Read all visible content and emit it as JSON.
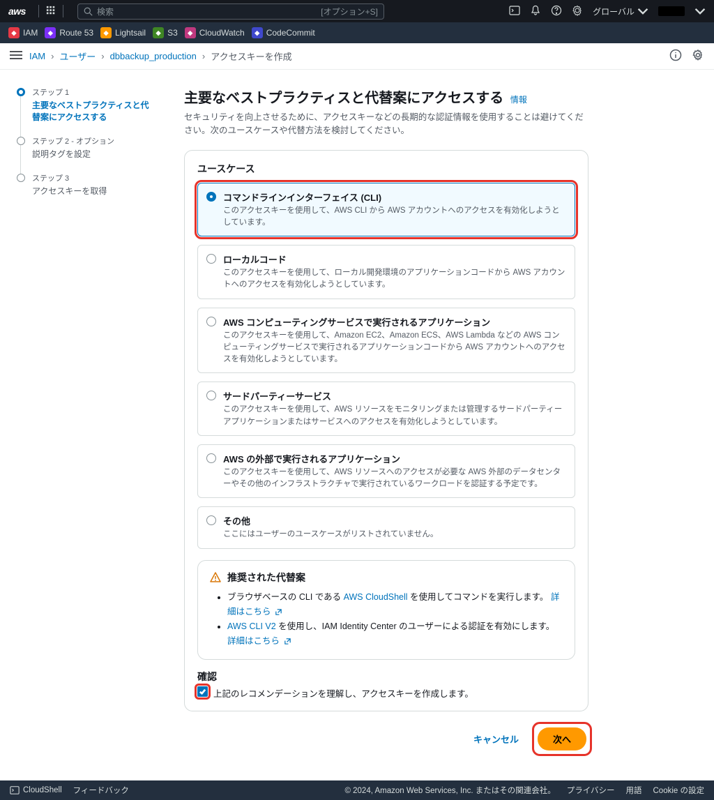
{
  "topnav": {
    "logo_text": "aws",
    "search_placeholder": "検索",
    "search_hint": "[オプション+S]",
    "region": "グローバル"
  },
  "servicebar": [
    {
      "label": "IAM",
      "color": "#e63946"
    },
    {
      "label": "Route 53",
      "color": "#7b2ff7"
    },
    {
      "label": "Lightsail",
      "color": "#ff9900"
    },
    {
      "label": "S3",
      "color": "#3f8624"
    },
    {
      "label": "CloudWatch",
      "color": "#c0397f"
    },
    {
      "label": "CodeCommit",
      "color": "#3f48cc"
    }
  ],
  "breadcrumb": {
    "items": [
      "IAM",
      "ユーザー",
      "dbbackup_production"
    ],
    "current": "アクセスキーを作成"
  },
  "stepper": [
    {
      "label": "ステップ 1",
      "title": "主要なベストプラクティスと代替案にアクセスする"
    },
    {
      "label": "ステップ 2 - オプション",
      "title": "説明タグを設定"
    },
    {
      "label": "ステップ 3",
      "title": "アクセスキーを取得"
    }
  ],
  "main": {
    "heading": "主要なベストプラクティスと代替案にアクセスする",
    "info": "情報",
    "subhead": "セキュリティを向上させるために、アクセスキーなどの長期的な認証情報を使用することは避けてください。次のユースケースや代替方法を検討してください。",
    "usecase_title": "ユースケース",
    "options": [
      {
        "title": "コマンドラインインターフェイス (CLI)",
        "desc": "このアクセスキーを使用して、AWS CLI から AWS アカウントへのアクセスを有効化しようとしています。"
      },
      {
        "title": "ローカルコード",
        "desc": "このアクセスキーを使用して、ローカル開発環境のアプリケーションコードから AWS アカウントへのアクセスを有効化しようとしています。"
      },
      {
        "title": "AWS コンピューティングサービスで実行されるアプリケーション",
        "desc": "このアクセスキーを使用して、Amazon EC2、Amazon ECS、AWS Lambda などの AWS コンピューティングサービスで実行されるアプリケーションコードから AWS アカウントへのアクセスを有効化しようとしています。"
      },
      {
        "title": "サードパーティーサービス",
        "desc": "このアクセスキーを使用して、AWS リソースをモニタリングまたは管理するサードパーティーアプリケーションまたはサービスへのアクセスを有効化しようとしています。"
      },
      {
        "title": "AWS の外部で実行されるアプリケーション",
        "desc": "このアクセスキーを使用して、AWS リソースへのアクセスが必要な AWS 外部のデータセンターやその他のインフラストラクチャで実行されているワークロードを認証する予定です。"
      },
      {
        "title": "その他",
        "desc": "ここにはユーザーのユースケースがリストされていません。"
      }
    ],
    "alert": {
      "title": "推奨された代替案",
      "b1_pre": "ブラウザベースの CLI である ",
      "b1_link": "AWS CloudShell",
      "b1_post": " を使用してコマンドを実行します。 ",
      "b1_more": "詳細はこちら",
      "b2_link": "AWS CLI V2",
      "b2_post": " を使用し、IAM Identity Center のユーザーによる認証を有効にします。 ",
      "b2_more": "詳細はこちら"
    },
    "confirm_label": "確認",
    "confirm_text": "上記のレコメンデーションを理解し、アクセスキーを作成します。",
    "cancel": "キャンセル",
    "next": "次へ"
  },
  "footer": {
    "cloudshell": "CloudShell",
    "feedback": "フィードバック",
    "copyright": "© 2024, Amazon Web Services, Inc. またはその関連会社。",
    "privacy": "プライバシー",
    "terms": "用語",
    "cookie": "Cookie の設定"
  }
}
